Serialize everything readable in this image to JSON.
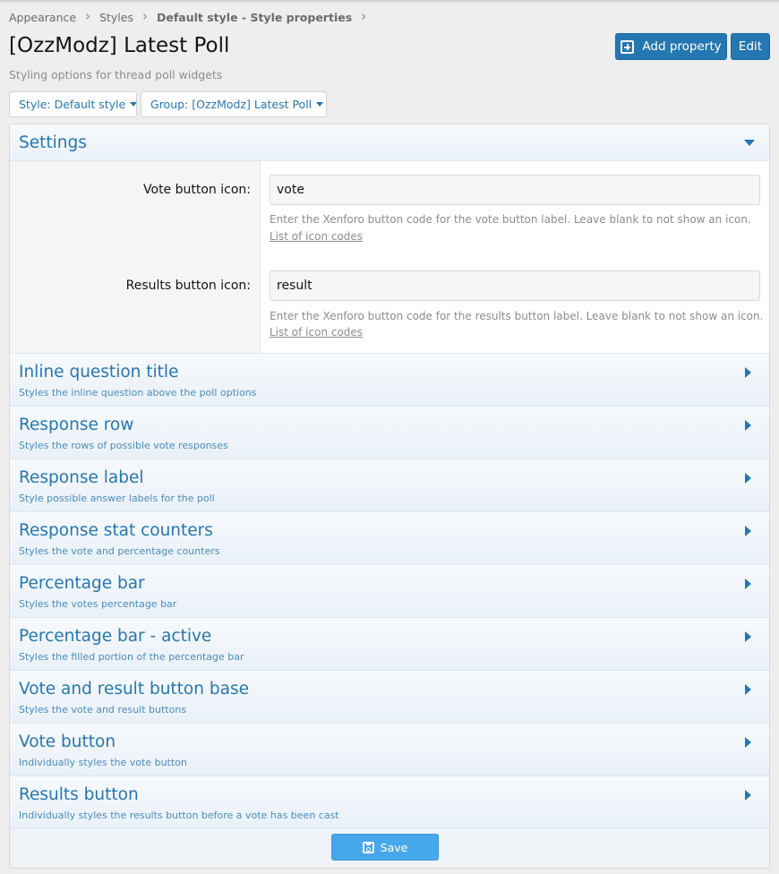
{
  "breadcrumb": {
    "items": [
      "Appearance",
      "Styles",
      "Default style - Style properties"
    ]
  },
  "header": {
    "title": "[OzzModz] Latest Poll",
    "description": "Styling options for thread poll widgets",
    "add_property_label": "Add property",
    "edit_label": "Edit"
  },
  "filters": {
    "style_label": "Style: Default style",
    "group_label": "Group: [OzzModz] Latest Poll"
  },
  "settings": {
    "title": "Settings",
    "vote_icon": {
      "label": "Vote button icon:",
      "value": "vote",
      "hint": "Enter the Xenforo button code for the vote button label. Leave blank to not show an icon.",
      "link": "List of icon codes"
    },
    "results_icon": {
      "label": "Results button icon:",
      "value": "result",
      "hint": "Enter the Xenforo button code for the results button label. Leave blank to not show an icon.",
      "link": "List of icon codes"
    }
  },
  "sections": [
    {
      "title": "Inline question title",
      "desc": "Styles the inline question above the poll options"
    },
    {
      "title": "Response row",
      "desc": "Styles the rows of possible vote responses"
    },
    {
      "title": "Response label",
      "desc": "Style possible answer labels for the poll"
    },
    {
      "title": "Response stat counters",
      "desc": "Styles the vote and percentage counters"
    },
    {
      "title": "Percentage bar",
      "desc": "Styles the votes percentage bar"
    },
    {
      "title": "Percentage bar - active",
      "desc": "Styles the filled portion of the percentage bar"
    },
    {
      "title": "Vote and result button base",
      "desc": "Styles the vote and result buttons"
    },
    {
      "title": "Vote button",
      "desc": "Individually styles the vote button"
    },
    {
      "title": "Results button",
      "desc": "Individually styles the results button before a vote has been cast"
    }
  ],
  "footer": {
    "save_label": "Save"
  },
  "colors": {
    "accent": "#2577b1",
    "save_button": "#47a7eb",
    "background": "#eeeeee"
  },
  "icons": {
    "add": "plus-square-icon",
    "save": "floppy-disk-icon",
    "expand": "caret-right-icon",
    "collapse": "caret-down-icon",
    "breadcrumb_separator": "chevron-right-icon"
  }
}
